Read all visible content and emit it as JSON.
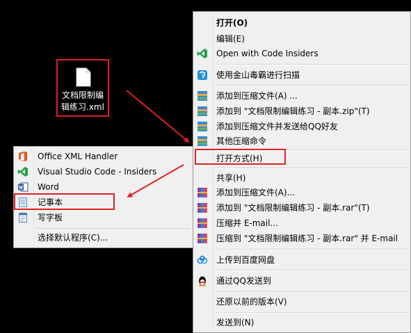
{
  "desktop": {
    "file": {
      "name": "文档限制编辑练习.xml",
      "line1": "文档限制编",
      "line2": "辑练习.xml",
      "icon": "document-file-icon"
    }
  },
  "context_menu": {
    "items": [
      {
        "label": "打开(O)",
        "bold": true,
        "icon": ""
      },
      {
        "label": "编辑(E)",
        "icon": ""
      },
      {
        "label": "Open with Code Insiders",
        "icon": "vscode-insiders-icon"
      },
      {
        "label": "使用金山毒霸进行扫描",
        "icon": "kingsoft-antivirus-icon"
      },
      {
        "label": "添加到压缩文件(A) ...",
        "icon": "archive-icon"
      },
      {
        "label": "添加到 \"文档限制编辑练习 - 副本.zip\"(T)",
        "icon": "archive-icon"
      },
      {
        "label": "添加到压缩文件并发送给QQ好友",
        "icon": "archive-icon"
      },
      {
        "label": "其他压缩命令",
        "icon": "archive-icon"
      },
      {
        "label": "打开方式(H)",
        "icon": ""
      },
      {
        "label": "共享(H)",
        "icon": ""
      },
      {
        "label": "添加到压缩文件(A)...",
        "icon": "winrar-icon"
      },
      {
        "label": "添加到 \"文档限制编辑练习 - 副本.rar\"(T)",
        "icon": "winrar-icon"
      },
      {
        "label": "压缩并 E-mail...",
        "icon": "winrar-icon"
      },
      {
        "label": "压缩到 \"文档限制编辑练习 - 副本.rar\" 并 E-mail",
        "icon": "winrar-icon"
      },
      {
        "label": "上传到百度网盘",
        "icon": "baidu-netdisk-icon"
      },
      {
        "label": "通过QQ发送到",
        "icon": "qq-penguin-icon"
      },
      {
        "label": "还原以前的版本(V)",
        "icon": ""
      },
      {
        "label": "发送到(N)",
        "icon": ""
      }
    ]
  },
  "open_with_submenu": {
    "items": [
      {
        "label": "Office XML Handler",
        "icon": "office-icon"
      },
      {
        "label": "Visual Studio Code - Insiders",
        "icon": "vscode-insiders-icon"
      },
      {
        "label": "Word",
        "icon": "word-icon"
      },
      {
        "label": "记事本",
        "icon": "notepad-icon"
      },
      {
        "label": "写字板",
        "icon": "wordpad-icon"
      },
      {
        "label": "选择默认程序(C)...",
        "icon": ""
      }
    ]
  },
  "colors": {
    "highlight": "#e02020",
    "menu_bg": "#f0f0f0",
    "desktop_bg": "#000000"
  }
}
